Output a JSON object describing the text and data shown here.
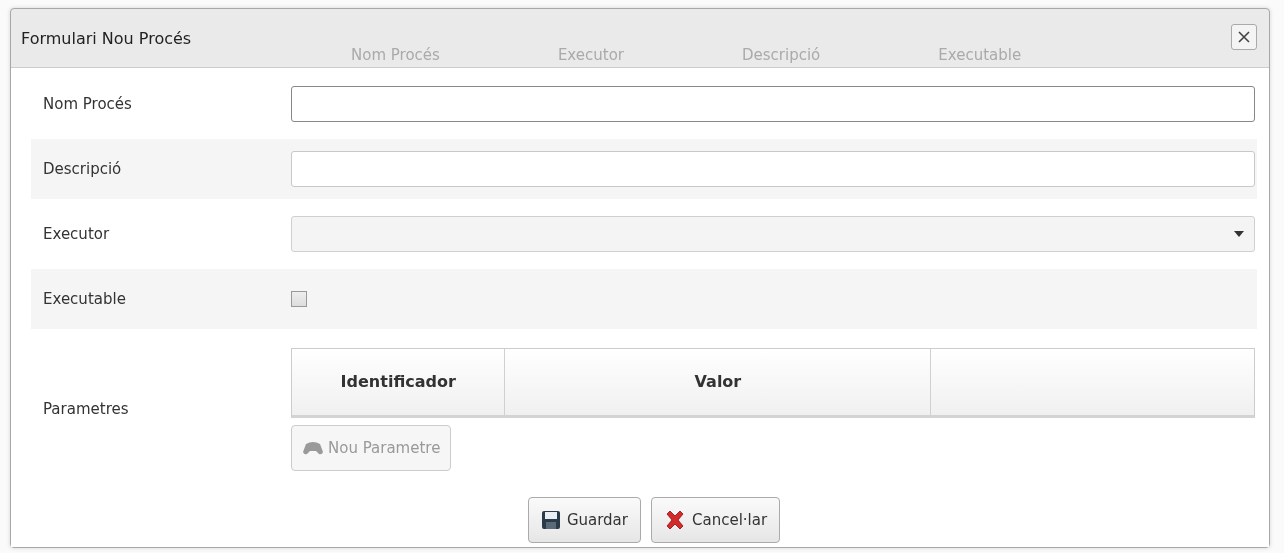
{
  "background_table": {
    "columns": [
      "Nom Procés",
      "Executor",
      "Descripció",
      "Executable"
    ]
  },
  "dialog": {
    "title": "Formulari Nou Procés"
  },
  "fields": [
    {
      "kind": "text",
      "label": "Nom Procés",
      "focused": true
    },
    {
      "kind": "text",
      "label": "Descripció",
      "focused": false
    },
    {
      "kind": "select",
      "label": "Executor"
    },
    {
      "kind": "checkbox",
      "label": "Executable",
      "checked": false
    },
    {
      "kind": "grid",
      "label": "Parametres",
      "columns": [
        "Identificador",
        "Valor",
        ""
      ],
      "add_button": {
        "label": "Nou Parametre",
        "disabled": true
      }
    }
  ],
  "buttons": [
    {
      "kind": "save",
      "label": "Guardar"
    },
    {
      "kind": "cancel",
      "label": "Cancel·lar"
    }
  ]
}
